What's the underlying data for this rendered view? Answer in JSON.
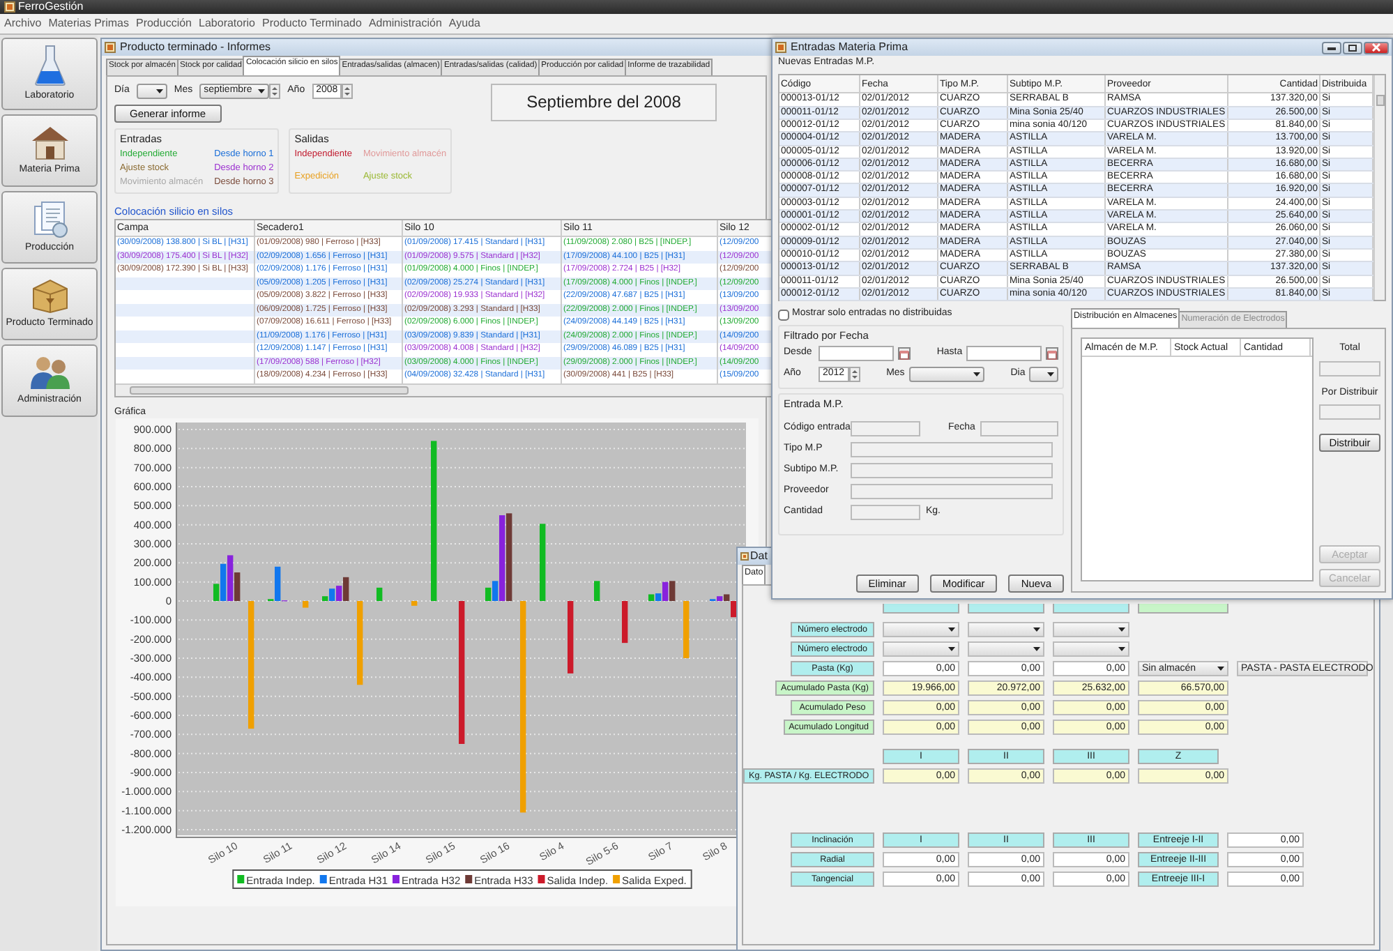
{
  "app": {
    "title": "FerroGestión"
  },
  "menu": [
    "Archivo",
    "Materias Primas",
    "Producción",
    "Laboratorio",
    "Producto Terminado",
    "Administración",
    "Ayuda"
  ],
  "sidebar": [
    {
      "label": "Laboratorio",
      "kind": "lab"
    },
    {
      "label": "Materia Prima",
      "kind": "material"
    },
    {
      "label": "Producción",
      "kind": "production"
    },
    {
      "label": "Producto Terminado",
      "kind": "product"
    },
    {
      "label": "Administración",
      "kind": "admin"
    }
  ],
  "report_window": {
    "title": "Producto terminado - Informes",
    "tabs": [
      {
        "label": "Stock por almacén",
        "selected": false
      },
      {
        "label": "Stock por calidad",
        "selected": false
      },
      {
        "label": "Colocación silicio en silos",
        "selected": true
      },
      {
        "label": "Entradas/salidas (almacen)",
        "selected": false
      },
      {
        "label": "Entradas/salidas (calidad)",
        "selected": false
      },
      {
        "label": "Producción por calidad",
        "selected": false
      },
      {
        "label": "Informe de trazabilidad",
        "selected": false
      }
    ],
    "day_label": "Día",
    "month_label": "Mes",
    "month": "septiembre",
    "year_label": "Año",
    "year": "2008",
    "generate_button": "Generar informe",
    "period_title": "Septiembre del 2008",
    "entradas": {
      "title": "Entradas",
      "items": [
        {
          "label": "Independiente",
          "color": "#22aa33"
        },
        {
          "label": "Desde horno 1",
          "color": "#1a6ed8"
        },
        {
          "label": "Ajuste stock",
          "color": "#8a6a30"
        },
        {
          "label": "Desde horno 2",
          "color": "#9b30d0"
        },
        {
          "label": "Movimiento almacén",
          "color": "#a8a8a8"
        },
        {
          "label": "Desde horno 3",
          "color": "#7a4a3a"
        }
      ]
    },
    "salidas": {
      "title": "Salidas",
      "items": [
        {
          "label": "Independiente",
          "color": "#c0182c"
        },
        {
          "label": "Movimiento almacén",
          "color": "#e09a9a"
        },
        {
          "label": "Expedición",
          "color": "#e8a020"
        },
        {
          "label": "Ajuste stock",
          "color": "#9ab832"
        }
      ]
    },
    "silos_table": {
      "title": "Colocación silicio en silos",
      "columns": [
        "Campa",
        "Secadero1",
        "Silo 10",
        "Silo 11",
        "Silo 12"
      ],
      "rows": [
        [
          {
            "text": "(30/09/2008) 138.800 | Si BL | [H31]",
            "color": "#1a6ed8"
          },
          {
            "text": "(01/09/2008) 980 | Ferroso | [H33]",
            "color": "#7a4a3a"
          },
          {
            "text": "(01/09/2008) 17.415 | Standard | [H31]",
            "color": "#1a6ed8"
          },
          {
            "text": "(11/09/2008) 2.080 | B25 | [INDEP.]",
            "color": "#22aa33"
          },
          {
            "text": "(12/09/200",
            "color": "#1a6ed8"
          }
        ],
        [
          {
            "text": "(30/09/2008) 175.400 | Si BL | [H32]",
            "color": "#9b30d0"
          },
          {
            "text": "(02/09/2008) 1.656 | Ferroso | [H31]",
            "color": "#1a6ed8"
          },
          {
            "text": "(01/09/2008) 9.575 | Standard | [H32]",
            "color": "#9b30d0"
          },
          {
            "text": "(17/09/2008) 44.100 | B25 | [H31]",
            "color": "#1a6ed8"
          },
          {
            "text": "(12/09/200",
            "color": "#9b30d0"
          }
        ],
        [
          {
            "text": "(30/09/2008) 172.390 | Si BL | [H33]",
            "color": "#7a4a3a"
          },
          {
            "text": "(02/09/2008) 1.176 | Ferroso | [H31]",
            "color": "#1a6ed8"
          },
          {
            "text": "(01/09/2008) 4.000 | Finos | [INDEP.]",
            "color": "#22aa33"
          },
          {
            "text": "(17/09/2008) 2.724 | B25 | [H32]",
            "color": "#9b30d0"
          },
          {
            "text": "(12/09/200",
            "color": "#7a4a3a"
          }
        ],
        [
          null,
          {
            "text": "(05/09/2008) 1.205 | Ferroso | [H31]",
            "color": "#1a6ed8"
          },
          {
            "text": "(02/09/2008) 25.274 | Standard | [H31]",
            "color": "#1a6ed8"
          },
          {
            "text": "(17/09/2008) 4.000 | Finos | [INDEP.]",
            "color": "#22aa33"
          },
          {
            "text": "(12/09/200",
            "color": "#22aa33"
          }
        ],
        [
          null,
          {
            "text": "(05/09/2008) 3.822 | Ferroso | [H33]",
            "color": "#7a4a3a"
          },
          {
            "text": "(02/09/2008) 19.933 | Standard | [H32]",
            "color": "#9b30d0"
          },
          {
            "text": "(22/09/2008) 47.687 | B25 | [H31]",
            "color": "#1a6ed8"
          },
          {
            "text": "(13/09/200",
            "color": "#1a6ed8"
          }
        ],
        [
          null,
          {
            "text": "(06/09/2008) 1.725 | Ferroso | [H33]",
            "color": "#7a4a3a"
          },
          {
            "text": "(02/09/2008) 3.293 | Standard | [H33]",
            "color": "#7a4a3a"
          },
          {
            "text": "(22/09/2008) 2.000 | Finos | [INDEP.]",
            "color": "#22aa33"
          },
          {
            "text": "(13/09/200",
            "color": "#9b30d0"
          }
        ],
        [
          null,
          {
            "text": "(07/09/2008) 16.611 | Ferroso | [H33]",
            "color": "#7a4a3a"
          },
          {
            "text": "(02/09/2008) 6.000 | Finos | [INDEP.]",
            "color": "#22aa33"
          },
          {
            "text": "(24/09/2008) 44.149 | B25 | [H31]",
            "color": "#1a6ed8"
          },
          {
            "text": "(13/09/200",
            "color": "#22aa33"
          }
        ],
        [
          null,
          {
            "text": "(11/09/2008) 1.176 | Ferroso | [H31]",
            "color": "#1a6ed8"
          },
          {
            "text": "(03/09/2008) 9.839 | Standard | [H31]",
            "color": "#1a6ed8"
          },
          {
            "text": "(24/09/2008) 2.000 | Finos | [INDEP.]",
            "color": "#22aa33"
          },
          {
            "text": "(14/09/200",
            "color": "#1a6ed8"
          }
        ],
        [
          null,
          {
            "text": "(12/09/2008) 1.147 | Ferroso | [H31]",
            "color": "#1a6ed8"
          },
          {
            "text": "(03/09/2008) 4.008 | Standard | [H32]",
            "color": "#9b30d0"
          },
          {
            "text": "(29/09/2008) 46.089 | B25 | [H31]",
            "color": "#1a6ed8"
          },
          {
            "text": "(14/09/200",
            "color": "#9b30d0"
          }
        ],
        [
          null,
          {
            "text": "(17/09/2008) 588 | Ferroso | [H32]",
            "color": "#9b30d0"
          },
          {
            "text": "(03/09/2008) 4.000 | Finos | [INDEP.]",
            "color": "#22aa33"
          },
          {
            "text": "(29/09/2008) 2.000 | Finos | [INDEP.]",
            "color": "#22aa33"
          },
          {
            "text": "(14/09/200",
            "color": "#22aa33"
          }
        ],
        [
          null,
          {
            "text": "(18/09/2008) 4.234 | Ferroso | [H33]",
            "color": "#7a4a3a"
          },
          {
            "text": "(04/09/2008) 32.428 | Standard | [H31]",
            "color": "#1a6ed8"
          },
          {
            "text": "(30/09/2008) 441 | B25 | [H33]",
            "color": "#7a4a3a"
          },
          {
            "text": "(15/09/200",
            "color": "#1a6ed8"
          }
        ]
      ]
    },
    "chart": {
      "title": "Gráfica",
      "chart_data": {
        "type": "bar",
        "categories": [
          "Silo 10",
          "Silo 11",
          "Silo 12",
          "Silo 14",
          "Silo 15",
          "Silo 16",
          "Silo 4",
          "Silo 5-6",
          "Silo 7",
          "Silo 8"
        ],
        "series": [
          {
            "name": "Entrada Indep.",
            "color": "#11bb22",
            "values": [
              90000,
              10000,
              25000,
              70000,
              840000,
              70000,
              405000,
              105000,
              35000,
              null
            ]
          },
          {
            "name": "Entrada H31",
            "color": "#1177ee",
            "values": [
              195000,
              180000,
              65000,
              null,
              null,
              105000,
              null,
              null,
              40000,
              10000
            ]
          },
          {
            "name": "Entrada H32",
            "color": "#8822dd",
            "values": [
              240000,
              3000,
              80000,
              null,
              null,
              450000,
              null,
              null,
              100000,
              25000
            ]
          },
          {
            "name": "Entrada H33",
            "color": "#6e3a36",
            "values": [
              150000,
              null,
              125000,
              null,
              null,
              460000,
              null,
              null,
              105000,
              35000
            ]
          },
          {
            "name": "Salida Indep.",
            "color": "#cc1a2a",
            "values": [
              null,
              null,
              null,
              null,
              -750000,
              null,
              -380000,
              -220000,
              null,
              -85000
            ]
          },
          {
            "name": "Salida Exped.",
            "color": "#f0a000",
            "values": [
              -670000,
              -35000,
              -440000,
              -25000,
              null,
              -1110000,
              null,
              null,
              -300000,
              null
            ]
          }
        ],
        "ylim": [
          -1200000,
          900000
        ],
        "grid": true,
        "legend": true,
        "yticks": [
          {
            "value": 900000,
            "label": "900.000"
          },
          {
            "value": 800000,
            "label": "800.000"
          },
          {
            "value": 700000,
            "label": "700.000"
          },
          {
            "value": 600000,
            "label": "600.000"
          },
          {
            "value": 500000,
            "label": "500.000"
          },
          {
            "value": 400000,
            "label": "400.000"
          },
          {
            "value": 300000,
            "label": "300.000"
          },
          {
            "value": 200000,
            "label": "200.000"
          },
          {
            "value": 100000,
            "label": "100.000"
          },
          {
            "value": 0,
            "label": "0"
          },
          {
            "value": -100000,
            "label": "-100.000"
          },
          {
            "value": -200000,
            "label": "-200.000"
          },
          {
            "value": -300000,
            "label": "-300.000"
          },
          {
            "value": -400000,
            "label": "-400.000"
          },
          {
            "value": -500000,
            "label": "-500.000"
          },
          {
            "value": -600000,
            "label": "-600.000"
          },
          {
            "value": -700000,
            "label": "-700.000"
          },
          {
            "value": -800000,
            "label": "-800.000"
          },
          {
            "value": -900000,
            "label": "-900.000"
          },
          {
            "value": -1000000,
            "label": "-1.000.000"
          },
          {
            "value": -1100000,
            "label": "-1.100.000"
          },
          {
            "value": -1200000,
            "label": "-1.200.000"
          }
        ]
      }
    }
  },
  "data_window": {
    "title": "Dat",
    "tab": {
      "label": "Dato",
      "selected": true
    },
    "header_stubs": [
      {
        "kind": "line"
      },
      {
        "kind": "line"
      },
      {
        "kind": "line"
      },
      {
        "kind": "total"
      }
    ],
    "groups": [
      [
        {
          "label": "Número electrodo",
          "kind": "input_label",
          "cells": [
            {
              "kind": "dropdown"
            },
            {
              "kind": "dropdown"
            },
            {
              "kind": "dropdown"
            }
          ]
        },
        {
          "label": "Número electrodo",
          "kind": "input_label",
          "cells": [
            {
              "kind": "dropdown"
            },
            {
              "kind": "dropdown"
            },
            {
              "kind": "dropdown"
            }
          ]
        },
        {
          "label": "Pasta (Kg)",
          "kind": "input_label",
          "cells": [
            {
              "kind": "input",
              "value": "0,00"
            },
            {
              "kind": "input",
              "value": "0,00"
            },
            {
              "kind": "input",
              "value": "0,00"
            },
            {
              "kind": "select",
              "value": "Sin almacén"
            },
            {
              "kind": "select",
              "value": "PASTA - PASTA ELECTRODO"
            }
          ]
        },
        {
          "label": "Acumulado Pasta (Kg)",
          "kind": "total_label",
          "cells": [
            {
              "kind": "readonly",
              "value": "19.966,00"
            },
            {
              "kind": "readonly",
              "value": "20.972,00"
            },
            {
              "kind": "readonly",
              "value": "25.632,00"
            },
            {
              "kind": "readonly",
              "value": "66.570,00"
            }
          ]
        },
        {
          "label": "Acumulado Peso",
          "kind": "total_label",
          "cells": [
            {
              "kind": "readonly",
              "value": "0,00"
            },
            {
              "kind": "readonly",
              "value": "0,00"
            },
            {
              "kind": "readonly",
              "value": "0,00"
            },
            {
              "kind": "readonly",
              "value": "0,00"
            }
          ]
        },
        {
          "label": "Acumulado Longitud",
          "kind": "total_label",
          "cells": [
            {
              "kind": "readonly",
              "value": "0,00"
            },
            {
              "kind": "readonly",
              "value": "0,00"
            },
            {
              "kind": "readonly",
              "value": "0,00"
            },
            {
              "kind": "readonly",
              "value": "0,00"
            }
          ]
        }
      ],
      [
        {
          "cells": [
            {
              "kind": "header",
              "text": "I"
            },
            {
              "kind": "header",
              "text": "II"
            },
            {
              "kind": "header",
              "text": "III"
            },
            {
              "kind": "header",
              "text": "Z"
            }
          ]
        },
        {
          "label": "Kg. PASTA / Kg. ELECTRODO",
          "kind": "input_label",
          "cells": [
            {
              "kind": "readonly",
              "value": "0,00"
            },
            {
              "kind": "readonly",
              "value": "0,00"
            },
            {
              "kind": "readonly",
              "value": "0,00"
            },
            {
              "kind": "readonly",
              "value": "0,00"
            }
          ]
        }
      ],
      [
        {
          "label": "Inclinación",
          "kind": "input_label",
          "cells": [
            {
              "kind": "header",
              "text": "I"
            },
            {
              "kind": "header",
              "text": "II"
            },
            {
              "kind": "header",
              "text": "III"
            },
            {
              "kind": "header",
              "text": "Entreeje I-II"
            },
            {
              "kind": "input",
              "value": "0,00"
            }
          ]
        },
        {
          "label": "Radial",
          "kind": "input_label",
          "cells": [
            {
              "kind": "input",
              "value": "0,00"
            },
            {
              "kind": "input",
              "value": "0,00"
            },
            {
              "kind": "input",
              "value": "0,00"
            },
            {
              "kind": "header",
              "text": "Entreeje II-III"
            },
            {
              "kind": "input",
              "value": "0,00"
            }
          ]
        },
        {
          "label": "Tangencial",
          "kind": "input_label",
          "cells": [
            {
              "kind": "input",
              "value": "0,00"
            },
            {
              "kind": "input",
              "value": "0,00"
            },
            {
              "kind": "input",
              "value": "0,00"
            },
            {
              "kind": "header",
              "text": "Entreeje III-I"
            },
            {
              "kind": "input",
              "value": "0,00"
            }
          ]
        }
      ]
    ]
  },
  "entries_window": {
    "title": "Entradas Materia Prima",
    "subtitle": "Nuevas Entradas M.P.",
    "table": {
      "columns": [
        "Código",
        "Fecha",
        "Tipo M.P.",
        "Subtipo M.P.",
        "Proveedor",
        "Cantidad",
        "Distribuida"
      ],
      "rows": [
        [
          "000013-01/12",
          "02/01/2012",
          "CUARZO",
          "SERRABAL B",
          "RAMSA",
          "137.320,00",
          "Si"
        ],
        [
          "000011-01/12",
          "02/01/2012",
          "CUARZO",
          "Mina Sonia 25/40",
          "CUARZOS INDUSTRIALES",
          "26.500,00",
          "Si"
        ],
        [
          "000012-01/12",
          "02/01/2012",
          "CUARZO",
          "mina sonia 40/120",
          "CUARZOS INDUSTRIALES",
          "81.840,00",
          "Si"
        ],
        [
          "000004-01/12",
          "02/01/2012",
          "MADERA",
          "ASTILLA",
          "VARELA M.",
          "13.700,00",
          "Si"
        ],
        [
          "000005-01/12",
          "02/01/2012",
          "MADERA",
          "ASTILLA",
          "VARELA M.",
          "13.920,00",
          "Si"
        ],
        [
          "000006-01/12",
          "02/01/2012",
          "MADERA",
          "ASTILLA",
          "BECERRA",
          "16.680,00",
          "Si"
        ],
        [
          "000008-01/12",
          "02/01/2012",
          "MADERA",
          "ASTILLA",
          "BECERRA",
          "16.680,00",
          "Si"
        ],
        [
          "000007-01/12",
          "02/01/2012",
          "MADERA",
          "ASTILLA",
          "BECERRA",
          "16.920,00",
          "Si"
        ],
        [
          "000003-01/12",
          "02/01/2012",
          "MADERA",
          "ASTILLA",
          "VARELA M.",
          "24.400,00",
          "Si"
        ],
        [
          "000001-01/12",
          "02/01/2012",
          "MADERA",
          "ASTILLA",
          "VARELA M.",
          "25.640,00",
          "Si"
        ],
        [
          "000002-01/12",
          "02/01/2012",
          "MADERA",
          "ASTILLA",
          "VARELA M.",
          "26.060,00",
          "Si"
        ],
        [
          "000009-01/12",
          "02/01/2012",
          "MADERA",
          "ASTILLA",
          "BOUZAS",
          "27.040,00",
          "Si"
        ],
        [
          "000010-01/12",
          "02/01/2012",
          "MADERA",
          "ASTILLA",
          "BOUZAS",
          "27.380,00",
          "Si"
        ],
        [
          "000013-01/12",
          "02/01/2012",
          "CUARZO",
          "SERRABAL B",
          "RAMSA",
          "137.320,00",
          "Si"
        ],
        [
          "000011-01/12",
          "02/01/2012",
          "CUARZO",
          "Mina Sonia 25/40",
          "CUARZOS INDUSTRIALES",
          "26.500,00",
          "Si"
        ],
        [
          "000012-01/12",
          "02/01/2012",
          "CUARZO",
          "mina sonia 40/120",
          "CUARZOS INDUSTRIALES",
          "81.840,00",
          "Si"
        ]
      ]
    },
    "filter_checkbox": {
      "label": "Mostrar solo entradas no distribuidas",
      "checked": false
    },
    "date_filter": {
      "title": "Filtrado por Fecha",
      "from_label": "Desde",
      "to_label": "Hasta",
      "year_label": "Año",
      "year": "2012",
      "month_label": "Mes",
      "day_label": "Dia"
    },
    "entry": {
      "title": "Entrada M.P.",
      "rows": [
        {
          "fields": [
            {
              "label": "Código entrada",
              "kind": "short"
            },
            {
              "label": "Fecha",
              "kind": "short"
            }
          ]
        },
        {
          "fields": [
            {
              "label": "Tipo M.P",
              "kind": "wide"
            }
          ]
        },
        {
          "fields": [
            {
              "label": "Subtipo M.P.",
              "kind": "wide"
            }
          ]
        },
        {
          "fields": [
            {
              "label": "Proveedor",
              "kind": "wide"
            }
          ]
        },
        {
          "fields": [
            {
              "label": "Cantidad",
              "kind": "short",
              "unit": "Kg."
            }
          ]
        }
      ]
    },
    "actions": [
      "Eliminar",
      "Modificar",
      "Nueva"
    ],
    "tabs": [
      {
        "label": "Distribución en Almacenes",
        "selected": true,
        "disabled": false
      },
      {
        "label": "Numeración de Electrodos",
        "selected": false,
        "disabled": true
      }
    ],
    "distribution_columns": [
      "Almacén de M.P.",
      "Stock Actual",
      "Cantidad"
    ],
    "total_label": "Total",
    "pending_label": "Por Distribuir",
    "side_buttons": [
      {
        "label": "Distribuir",
        "disabled": false
      },
      {
        "label": "Aceptar",
        "disabled": true
      },
      {
        "label": "Cancelar",
        "disabled": true
      }
    ]
  }
}
